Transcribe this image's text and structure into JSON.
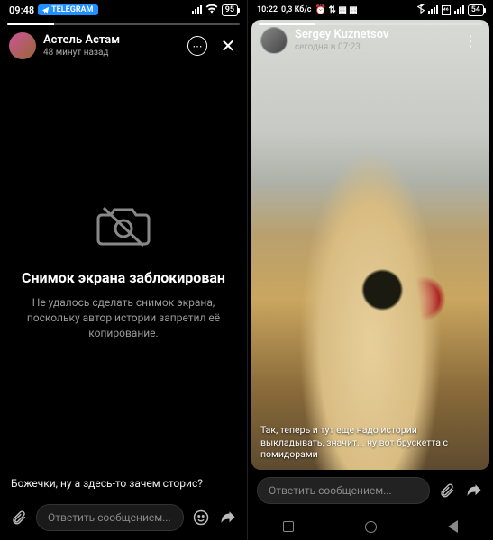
{
  "left": {
    "status": {
      "time": "09:48",
      "tg_label": "TELEGRAM",
      "battery": "95"
    },
    "user": {
      "name": "Астель Астам",
      "time": "48 минут назад"
    },
    "blocked": {
      "title": "Снимок экрана заблокирован",
      "desc": "Не удалось сделать снимок экрана, поскольку автор истории запретил её копирование."
    },
    "caption": "Божечки, ну а здесь-то зачем сторис?",
    "reply_placeholder": "Ответить сообщением..."
  },
  "right": {
    "status": {
      "time": "10:22",
      "net": "0,3 Кб/с",
      "battery": "54"
    },
    "user": {
      "name": "Sergey Kuznetsov",
      "time": "сегодня в 07:23"
    },
    "caption": "Так, теперь и тут еще надо истории выкладывать, значит... ну вот брускетта с помидорами",
    "reply_placeholder": "Ответить сообщением..."
  }
}
